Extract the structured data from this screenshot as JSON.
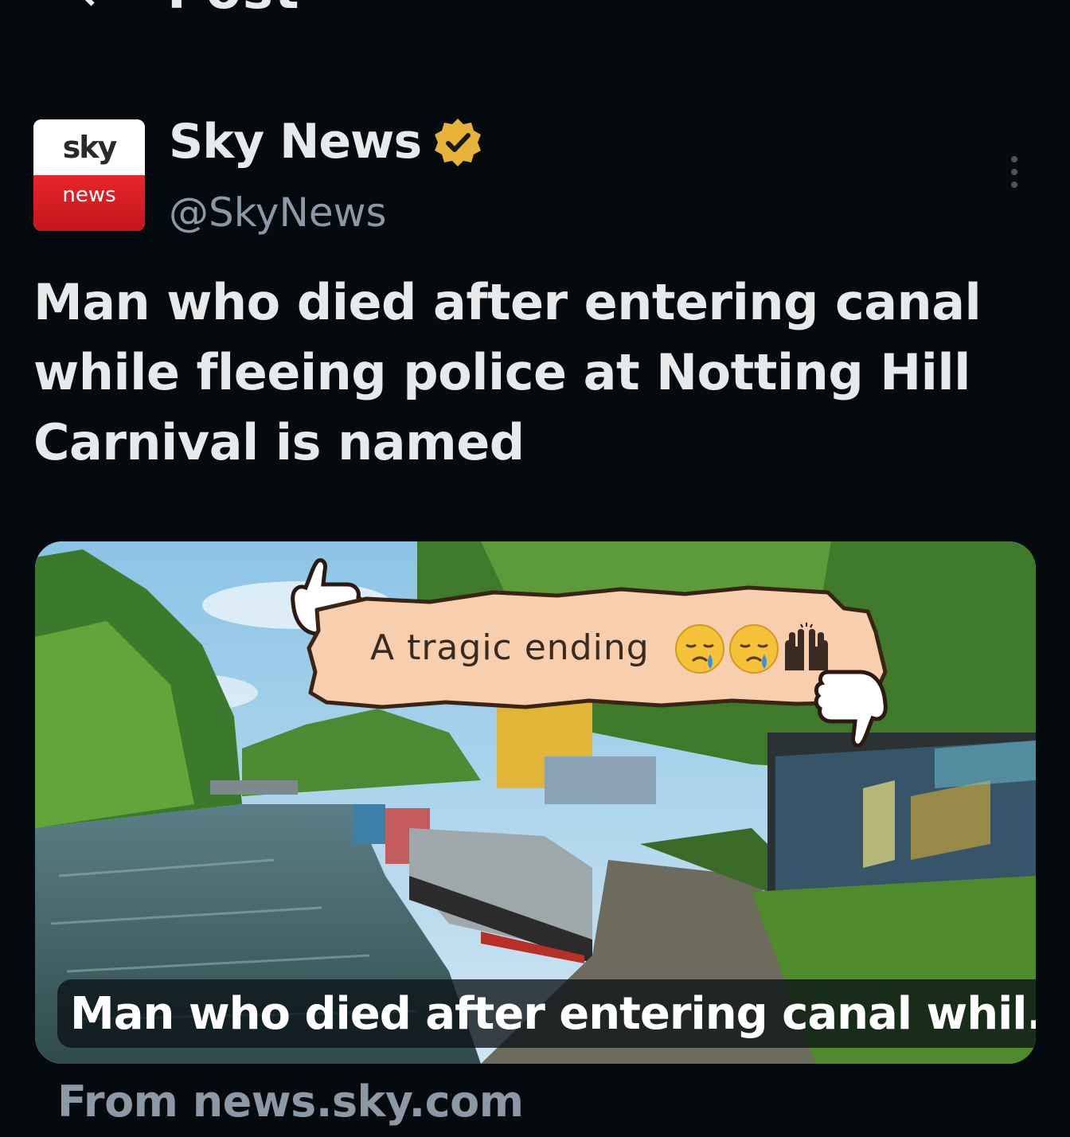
{
  "header": {
    "title": "Post",
    "back_icon": "arrow-left-icon",
    "right_icon": "refresh-icon"
  },
  "author": {
    "avatar_top_text": "sky",
    "avatar_bottom_text": "news",
    "display_name": "Sky News",
    "handle": "@SkyNews",
    "verified_badge_color": "#e8b339"
  },
  "post": {
    "text": "Man who died after entering canal while fleeing police at Notting Hill Carnival is named"
  },
  "card": {
    "caption": "Man who died after entering canal whil...",
    "sticker_text": "A tragic ending",
    "emojis": [
      "crying-face-icon",
      "crying-face-icon",
      "raised-hands-icon"
    ],
    "source": "From news.sky.com"
  },
  "colors": {
    "background": "#050a0e",
    "text_primary": "#e7e9ea",
    "text_secondary": "#8b98a5",
    "sticker_fill": "#f7cfae",
    "sky_red": "#d81e24"
  }
}
